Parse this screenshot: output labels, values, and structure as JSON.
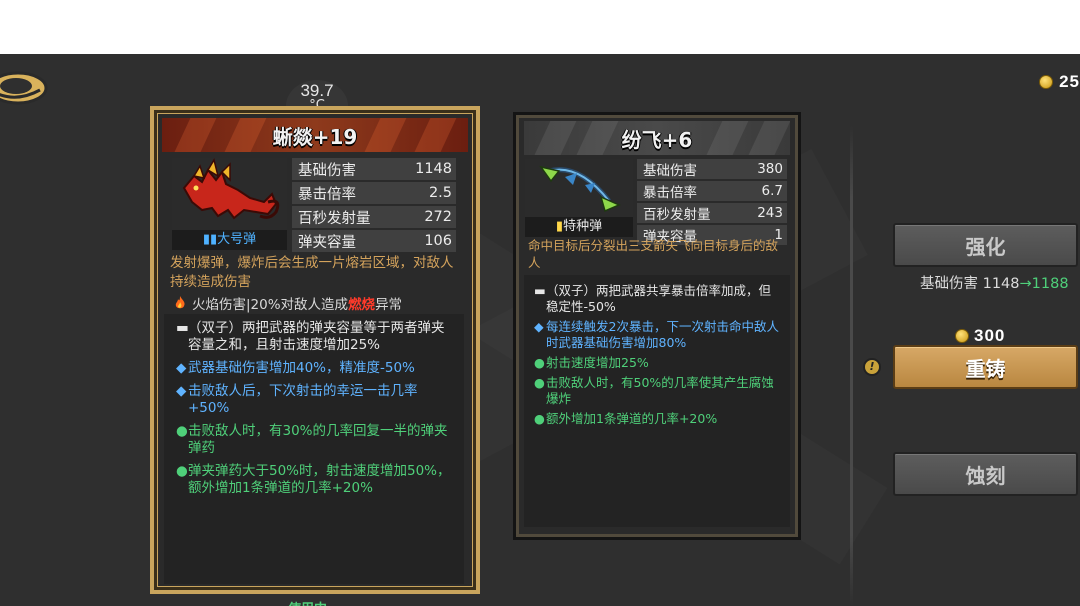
{
  "temperature": {
    "value": "39.7",
    "unit": "°C"
  },
  "currency": {
    "amount": "25"
  },
  "weapon_equipped": {
    "name": "蜥燚+19",
    "ammo_type": "大号弹",
    "stats": [
      {
        "label": "基础伤害",
        "value": "1148"
      },
      {
        "label": "暴击倍率",
        "value": "2.5"
      },
      {
        "label": "百秒发射量",
        "value": "272"
      },
      {
        "label": "弹夹容量",
        "value": "106"
      }
    ],
    "description": "发射爆弹，爆炸后会生成一片熔岩区域，对敌人持续造成伤害",
    "effect": {
      "pre": "火焰伤害|20%对敌人造成",
      "highlight": "燃烧",
      "post": "异常"
    },
    "traits": [
      {
        "color": "white",
        "text": "（双子）两把武器的弹夹容量等于两者弹夹容量之和，且射击速度增加25%"
      },
      {
        "color": "blue",
        "text": "武器基础伤害增加40%，精准度-50%"
      },
      {
        "color": "blue",
        "text": "击败敌人后，下次射击的幸运一击几率+50%"
      },
      {
        "color": "green",
        "text": "击败敌人时，有30%的几率回复一半的弹夹弹药"
      },
      {
        "color": "green",
        "text": "弹夹弹药大于50%时，射击速度增加50%，额外增加1条弹道的几率+20%"
      }
    ],
    "status": "使用中"
  },
  "weapon_compare": {
    "name": "纷飞+6",
    "ammo_type": "特种弹",
    "stats": [
      {
        "label": "基础伤害",
        "value": "380"
      },
      {
        "label": "暴击倍率",
        "value": "6.7"
      },
      {
        "label": "百秒发射量",
        "value": "243"
      },
      {
        "label": "弹夹容量",
        "value": "1"
      }
    ],
    "description": "命中目标后分裂出三支箭矢飞向目标身后的敌人",
    "traits": [
      {
        "color": "white",
        "text": "（双子）两把武器共享暴击倍率加成，但稳定性-50%"
      },
      {
        "color": "blue",
        "text": "每连续触发2次暴击，下一次射击命中敌人时武器基础伤害增加80%"
      },
      {
        "color": "green",
        "text": "射击速度增加25%"
      },
      {
        "color": "green",
        "text": "击败敌人时，有50%的几率使其产生腐蚀爆炸"
      },
      {
        "color": "green",
        "text": "额外增加1条弹道的几率+20%"
      }
    ]
  },
  "actions": {
    "upgrade_label": "强化",
    "damage_label": "基础伤害",
    "damage_current": "1148",
    "damage_arrow": "→",
    "damage_next": "1188",
    "reforge_cost": "300",
    "reforge_label": "重铸",
    "etch_label": "蚀刻"
  },
  "colors": {
    "trait_white": "#e6e6e6",
    "trait_blue": "#5fb3ff",
    "trait_green": "#4fd07a",
    "burn_red": "#ff3a2a",
    "card_gold_border": "#c9a55d",
    "gold_button": "#c9974f",
    "ammo_blue": "#4fb2ff",
    "ammo_yellow": "#ffd84a"
  }
}
